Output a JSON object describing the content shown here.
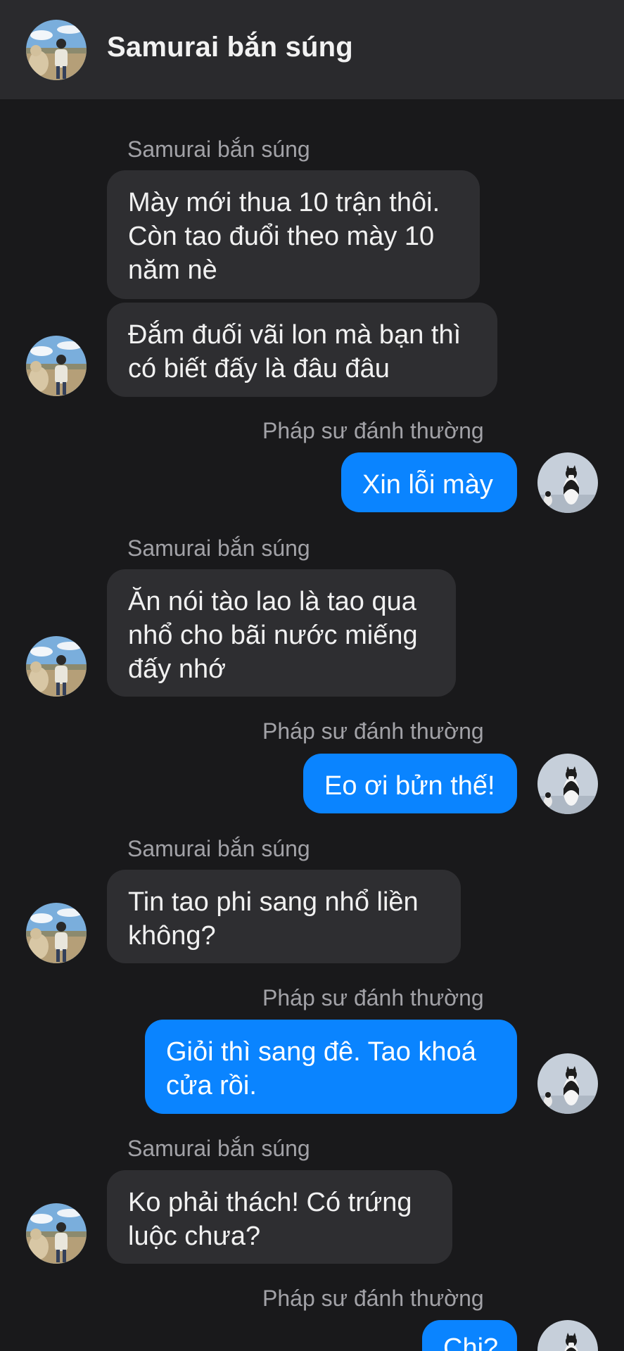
{
  "header": {
    "title": "Samurai bắn súng"
  },
  "contacts": {
    "other_name": "Samurai bắn súng",
    "self_name": "Pháp sư đánh thường"
  },
  "messages": [
    {
      "from": "other",
      "text": "Mày mới thua 10 trận thôi.\nCòn tao đuổi theo mày 10\nnăm nè"
    },
    {
      "from": "other",
      "text": "Đắm đuối vãi lon mà bạn thì\ncó biết đấy là đâu đâu"
    },
    {
      "from": "self",
      "text": "Xin lỗi mày"
    },
    {
      "from": "other",
      "text": "Ăn nói tào lao là tao qua\nnhổ cho bãi nước miếng\nđấy nhớ"
    },
    {
      "from": "self",
      "text": "Eo ơi bửn thế!"
    },
    {
      "from": "other",
      "text": "Tin tao phi sang nhổ liền\nkhông?"
    },
    {
      "from": "self",
      "text": "Giỏi thì sang đê. Tao khoá\ncửa rồi."
    },
    {
      "from": "other",
      "text": "Ko phải thách! Có trứng\nluộc chưa?"
    },
    {
      "from": "self",
      "text": "Chi?"
    }
  ],
  "colors": {
    "background": "#19191b",
    "header": "#2a2a2d",
    "incoming_bubble": "#2e2e31",
    "outgoing_bubble": "#0a84ff"
  },
  "icons": {
    "other_avatar": "person-with-alpaca-avatar",
    "self_avatar": "cat-penguin-avatar"
  }
}
